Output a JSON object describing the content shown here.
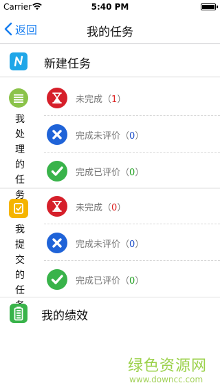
{
  "status": {
    "carrier": "Carrier",
    "time": "5:40 PM",
    "battery_level": 1.0
  },
  "nav": {
    "back": "返回",
    "title": "我的任务"
  },
  "new_task": {
    "label": "新建任务",
    "icon": "n-letter-icon"
  },
  "handled": {
    "label": "我处理的任务",
    "rows": [
      {
        "text": "未完成",
        "count": "1",
        "icon": "hourglass-icon"
      },
      {
        "text": "完成未评价",
        "count": "0",
        "icon": "x-circle-icon"
      },
      {
        "text": "完成已评价",
        "count": "0",
        "icon": "check-circle-icon"
      }
    ]
  },
  "submitted": {
    "label": "我提交的任务",
    "rows": [
      {
        "text": "未完成",
        "count": "0",
        "icon": "hourglass-icon"
      },
      {
        "text": "完成未评价",
        "count": "0",
        "icon": "x-circle-icon"
      },
      {
        "text": "完成已评价",
        "count": "0",
        "icon": "check-circle-icon"
      }
    ]
  },
  "performance": {
    "label": "我的绩效",
    "icon": "battery-icon"
  },
  "watermark": {
    "cn": "绿色资源网",
    "url": "www.downcc.com"
  },
  "colors": {
    "accent": "#1a7ff0",
    "red": "#d61f2a",
    "blue": "#1f63d8",
    "green": "#39b34a",
    "handled_icon": "#8bc34a",
    "submitted_icon": "#f5b400",
    "new_task_icon": "#1fa6e8"
  }
}
